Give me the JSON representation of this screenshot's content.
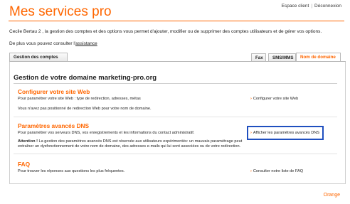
{
  "header": {
    "title": "Mes services pro",
    "links": [
      "Espace client",
      "Déconnexion"
    ]
  },
  "intro": {
    "text": "Cecile Bertau 2 , la gestion des comptes et des options vous permet d'ajouter, modifier ou de supprimer des comptes utilisateurs et de gérer vos options.",
    "help_prefix": "De plus vous pouvez consulter l'",
    "help_link": "assistance"
  },
  "tabs": {
    "left": "Gestion des comptes",
    "right": [
      "Fax",
      "SMS/MMS",
      "Nom de domaine"
    ],
    "active": "Nom de domaine"
  },
  "main": {
    "heading": "Gestion de votre domaine marketing-pro.org",
    "sections": [
      {
        "title": "Configurer votre site Web",
        "lines": [
          "Pour paramétrer votre site Web : type de redirection, adresses, métas",
          "Vous n'avez pas positionné de redirection Web pour votre nom de domaine."
        ],
        "link": "Configurer votre site Web"
      },
      {
        "title": "Paramètres avancés DNS",
        "lines": [
          "Pour paramétrer vos serveurs DNS, vos enregistrements et les informations du contact administratif.",
          "La gestion des paramètres avancés DNS est réservée aux utilisateurs expérimentés: un mauvais paramétrage peut",
          "entraîner un dysfonctionnement de votre nom de domaine, des adresses e-mails qui lui sont associées ou de votre redirection."
        ],
        "warning_label": "Attention !",
        "link": "Afficher les paramètres avancés DNS"
      },
      {
        "title": "FAQ",
        "lines": [
          "Pour trouver les réponses aux questions les plus fréquentes."
        ],
        "link": "Consulter notre liste de FAQ"
      }
    ]
  },
  "footer": {
    "brand": "Orange"
  },
  "colors": {
    "accent": "#ff6600",
    "highlight": "#1f4fbf"
  }
}
